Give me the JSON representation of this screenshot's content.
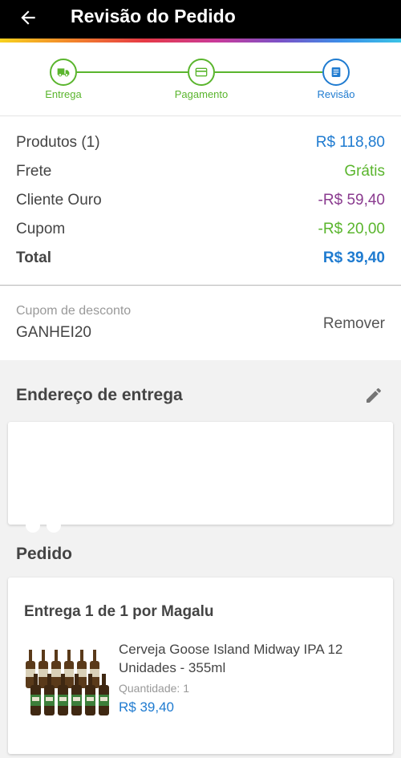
{
  "header": {
    "title": "Revisão do Pedido",
    "back_icon": "arrow-left-icon"
  },
  "stepper": {
    "steps": [
      {
        "label": "Entrega",
        "icon": "truck-icon",
        "status": "done"
      },
      {
        "label": "Pagamento",
        "icon": "card-icon",
        "status": "done"
      },
      {
        "label": "Revisão",
        "icon": "list-icon",
        "status": "active"
      }
    ]
  },
  "summary": {
    "rows": [
      {
        "label": "Produtos (1)",
        "value": "R$ 118,80"
      },
      {
        "label": "Frete",
        "value": "Grátis"
      },
      {
        "label": "Cliente Ouro",
        "value": "-R$ 59,40"
      },
      {
        "label": "Cupom",
        "value": "-R$ 20,00"
      },
      {
        "label": "Total",
        "value": "R$ 39,40"
      }
    ]
  },
  "coupon": {
    "label": "Cupom de desconto",
    "code": "GANHEI20",
    "remove_label": "Remover"
  },
  "address": {
    "title": "Endereço de entrega",
    "edit_icon": "pencil-icon"
  },
  "order": {
    "title": "Pedido",
    "delivery_label": "Entrega 1 de 1 por Magalu",
    "product": {
      "name": "Cerveja Goose Island Midway IPA 12 Unidades - 355ml",
      "quantity_label": "Quantidade:",
      "quantity": "1",
      "price": "R$ 39,40"
    }
  },
  "colors": {
    "primary_blue": "#1f7bd0",
    "green": "#5ab52d",
    "purple": "#8a3b8f"
  }
}
